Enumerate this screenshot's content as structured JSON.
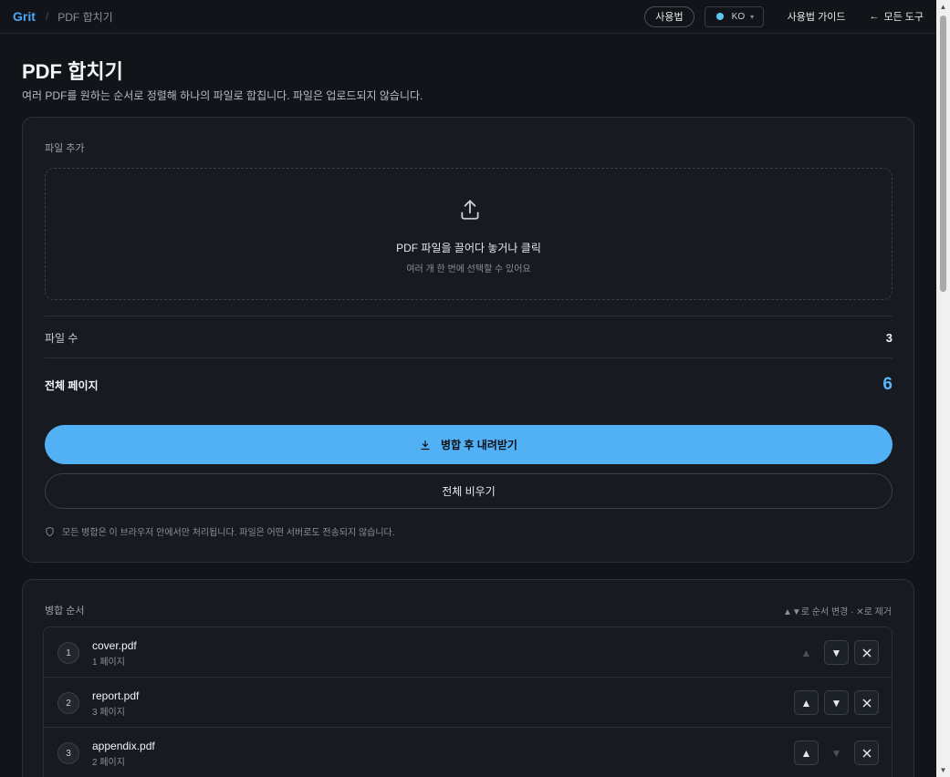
{
  "header": {
    "brand": "Grit",
    "separator": "/",
    "breadcrumb": "PDF 합치기",
    "usage_button": "사용법",
    "lang_label": "KO",
    "guide_link": "사용법 가이드",
    "all_tools_link": "모든 도구",
    "back_arrow": "←"
  },
  "page": {
    "title": "PDF 합치기",
    "subtitle": "여러 PDF를 원하는 순서로 정렬해 하나의 파일로 합칩니다. 파일은 업로드되지 않습니다."
  },
  "add_section": {
    "label": "파일 추가",
    "drop_title": "PDF 파일을 끌어다 놓거나 클릭",
    "drop_hint": "여러 개 한 번에 선택할 수 있어요"
  },
  "stats": {
    "file_count_label": "파일 수",
    "file_count": "3",
    "total_pages_label": "전체 페이지",
    "total_pages": "6"
  },
  "actions": {
    "merge_download": "병합 후 내려받기",
    "clear_all": "전체 비우기"
  },
  "privacy_note": "모든 병합은 이 브라우저 안에서만 처리됩니다. 파일은 어떤 서버로도 전송되지 않습니다.",
  "order_section": {
    "label": "병합 순서",
    "hint": "▲▼로 순서 변경 · ✕로 제거",
    "files": [
      {
        "index": "1",
        "name": "cover.pdf",
        "pages": "1 페이지",
        "up_enabled": false,
        "down_enabled": true
      },
      {
        "index": "2",
        "name": "report.pdf",
        "pages": "3 페이지",
        "up_enabled": true,
        "down_enabled": true
      },
      {
        "index": "3",
        "name": "appendix.pdf",
        "pages": "2 페이지",
        "up_enabled": true,
        "down_enabled": false
      }
    ]
  },
  "colors": {
    "accent": "#52b0f5",
    "background": "#111419",
    "card": "#171b21"
  }
}
